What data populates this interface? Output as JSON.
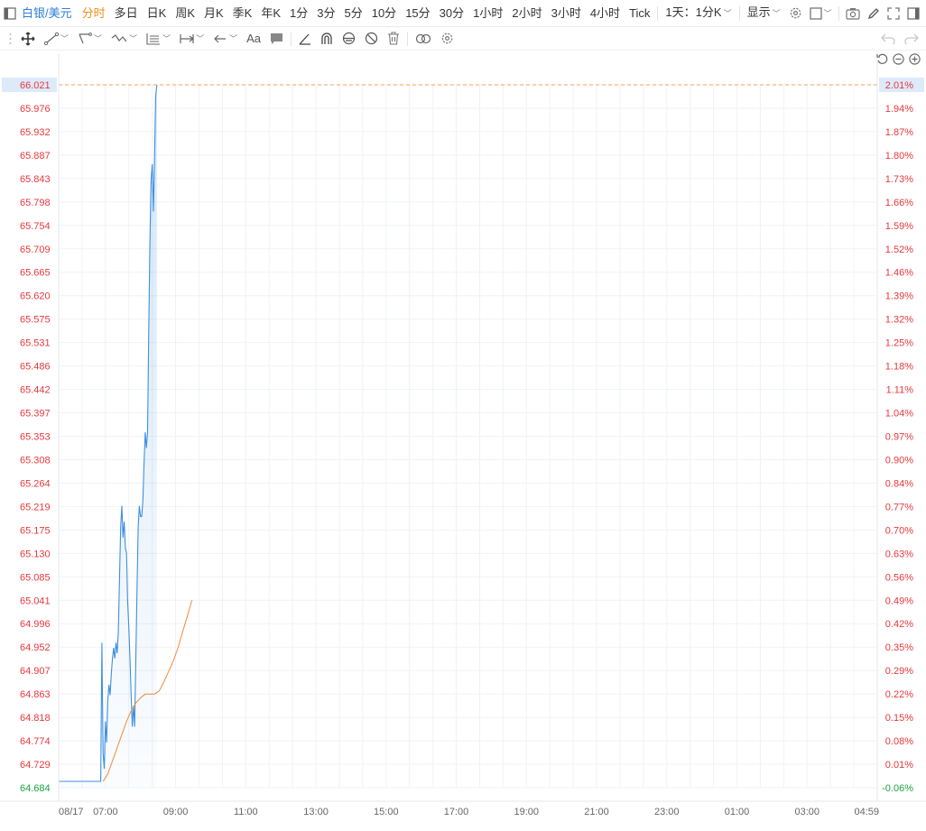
{
  "toolbar": {
    "symbol": "白银/美元",
    "periods": [
      "分时",
      "多日",
      "日K",
      "周K",
      "月K",
      "季K",
      "年K",
      "1分",
      "3分",
      "5分",
      "10分",
      "15分",
      "30分",
      "1小时",
      "2小时",
      "3小时",
      "4小时",
      "Tick"
    ],
    "active_period": "分时",
    "kline_setting": "1天：1分K",
    "display_label": "显示",
    "text_tool_label": "Aa"
  },
  "colors": {
    "price_line": "#3d8fe0",
    "avg_line": "#f08a3c",
    "up": "#e8383d",
    "down": "#19a33f",
    "grid": "#f0f2f5",
    "highlight_bg": "#dceafa",
    "ref_line": "#f3a35a"
  },
  "chart_data": {
    "type": "line",
    "series": [
      {
        "values_by_minute_from_0540": [
          64.696,
          64.696,
          64.696,
          64.696,
          64.696,
          64.696,
          64.696,
          64.696,
          64.696,
          64.696,
          64.696,
          64.696,
          64.696,
          64.696,
          64.696,
          64.696,
          64.696,
          64.696,
          64.696,
          64.696,
          64.696,
          64.696,
          64.696,
          64.696,
          64.696,
          64.696,
          64.696,
          64.696,
          64.696,
          64.696,
          64.696,
          64.696,
          64.696,
          64.696,
          64.696,
          64.696,
          64.696,
          64.96,
          64.75,
          64.72,
          64.81,
          64.77,
          64.85,
          64.88,
          64.86,
          64.9,
          64.93,
          64.95,
          64.93,
          64.96,
          64.94,
          64.98,
          65.08,
          65.18,
          65.22,
          65.16,
          65.19,
          65.14,
          65.13,
          65.04,
          64.99,
          64.93,
          64.86,
          64.8,
          64.84,
          64.8,
          64.93,
          65.06,
          65.18,
          65.22,
          65.2,
          65.2,
          65.23,
          65.3,
          65.36,
          65.33,
          65.36,
          65.55,
          65.72,
          65.84,
          65.87,
          65.78,
          65.88,
          66.0,
          66.021
        ],
        "minute_step": 2
      },
      {
        "avg_values": [
          64.696,
          64.71,
          64.735,
          64.76,
          64.785,
          64.81,
          64.83,
          64.845,
          64.855,
          64.862,
          64.862,
          64.862,
          64.868,
          64.885,
          64.905,
          64.925,
          64.95,
          64.98,
          65.01,
          65.041
        ],
        "start_minute_offset": 76,
        "minute_step": 8
      }
    ],
    "x_tick_labels": [
      "08/17",
      "07:00",
      "09:00",
      "11:00",
      "13:00",
      "15:00",
      "17:00",
      "19:00",
      "21:00",
      "23:00",
      "01:00",
      "03:00",
      "04:59"
    ],
    "x_tick_minutes_from_0540": [
      0,
      80,
      200,
      320,
      440,
      560,
      680,
      800,
      920,
      1040,
      1160,
      1280,
      1399
    ],
    "x_range_minutes": [
      0,
      1400
    ],
    "y_tick_labels_left": [
      "66.021",
      "65.976",
      "65.932",
      "65.887",
      "65.843",
      "65.798",
      "65.754",
      "65.709",
      "65.665",
      "65.620",
      "65.575",
      "65.531",
      "65.486",
      "65.442",
      "65.397",
      "65.353",
      "65.308",
      "65.264",
      "65.219",
      "65.175",
      "65.130",
      "65.085",
      "65.041",
      "64.996",
      "64.952",
      "64.907",
      "64.863",
      "64.818",
      "64.774",
      "64.729",
      "64.684"
    ],
    "y_tick_labels_right": [
      "2.01%",
      "1.94%",
      "1.87%",
      "1.80%",
      "1.73%",
      "1.66%",
      "1.59%",
      "1.52%",
      "1.46%",
      "1.39%",
      "1.32%",
      "1.25%",
      "1.18%",
      "1.11%",
      "1.04%",
      "0.97%",
      "0.90%",
      "0.84%",
      "0.77%",
      "0.70%",
      "0.63%",
      "0.56%",
      "0.49%",
      "0.42%",
      "0.35%",
      "0.29%",
      "0.22%",
      "0.15%",
      "0.08%",
      "0.01%",
      "-0.06%"
    ],
    "ylim": [
      64.684,
      66.021
    ],
    "current_price": 66.021,
    "current_pct": "2.01%",
    "grid": true
  }
}
